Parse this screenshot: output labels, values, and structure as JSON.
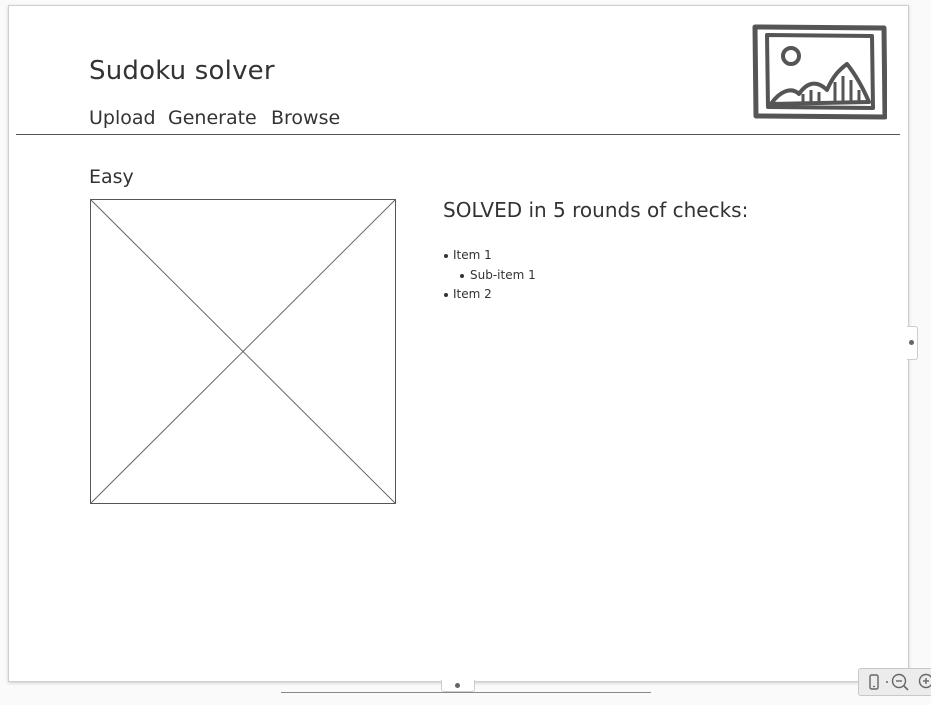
{
  "app": {
    "title": "Sudoku solver"
  },
  "nav": {
    "items": [
      {
        "label": "Upload"
      },
      {
        "label": "Generate"
      },
      {
        "label": "Browse"
      }
    ]
  },
  "logo": {
    "icon": "image-icon"
  },
  "puzzle": {
    "difficulty": "Easy",
    "board_icon": "image-placeholder"
  },
  "result": {
    "heading": "SOLVED in 5 rounds of checks:",
    "items": [
      {
        "label": "Item 1",
        "level": 0
      },
      {
        "label": "Sub-item 1",
        "level": 1
      },
      {
        "label": "Item 2",
        "level": 0
      }
    ]
  },
  "controls": {
    "device_icon": "device-icon",
    "zoom_out_icon": "zoom-out-icon",
    "zoom_in_icon": "zoom-in-icon"
  },
  "colors": {
    "ink": "#333333",
    "line": "#555555",
    "sheet": "#ffffff"
  }
}
